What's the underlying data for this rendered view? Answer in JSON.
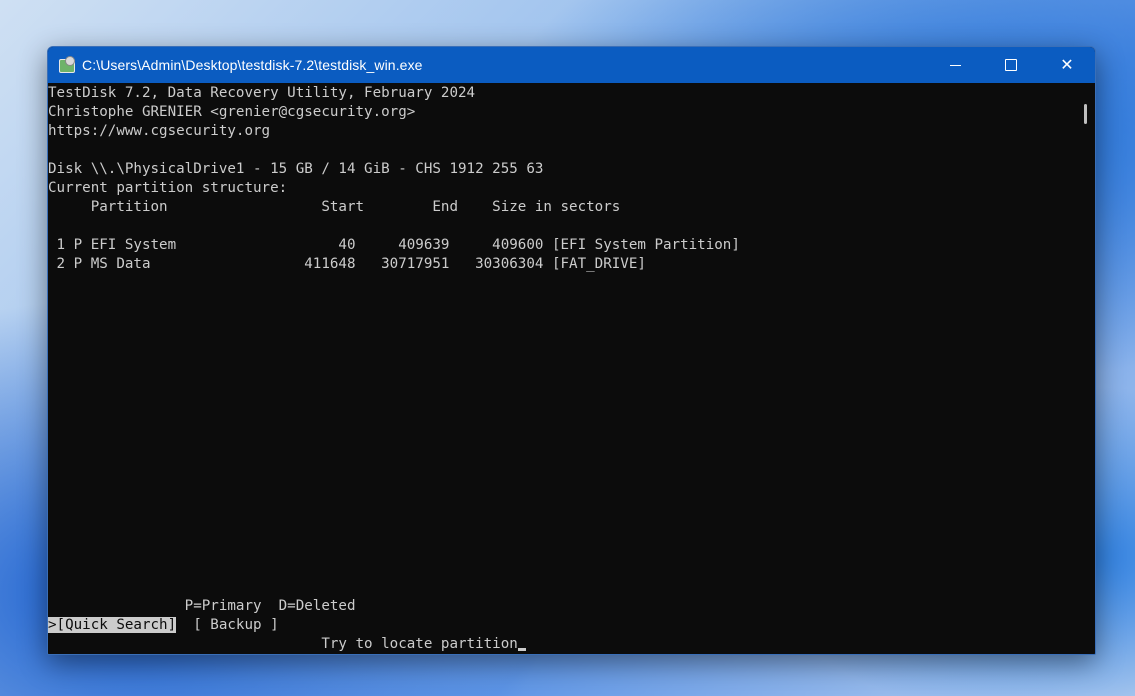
{
  "window": {
    "title": "C:\\Users\\Admin\\Desktop\\testdisk-7.2\\testdisk_win.exe",
    "close_glyph": "✕"
  },
  "terminal": {
    "header_line1": "TestDisk 7.2, Data Recovery Utility, February 2024",
    "header_line2": "Christophe GRENIER <grenier@cgsecurity.org>",
    "header_line3": "https://www.cgsecurity.org",
    "disk_line": "Disk \\\\.\\PhysicalDrive1 - 15 GB / 14 GiB - CHS 1912 255 63",
    "structure_label": "Current partition structure:",
    "columns_line": "     Partition                  Start        End    Size in sectors",
    "partitions": [
      " 1 P EFI System                   40     409639     409600 [EFI System Partition]",
      " 2 P MS Data                  411648   30717951   30306304 [FAT_DRIVE]"
    ],
    "legend": "                P=Primary  D=Deleted",
    "menu_quick_search": ">[Quick Search]",
    "menu_backup": "  [ Backup ]",
    "hint": "                                Try to locate partition"
  }
}
